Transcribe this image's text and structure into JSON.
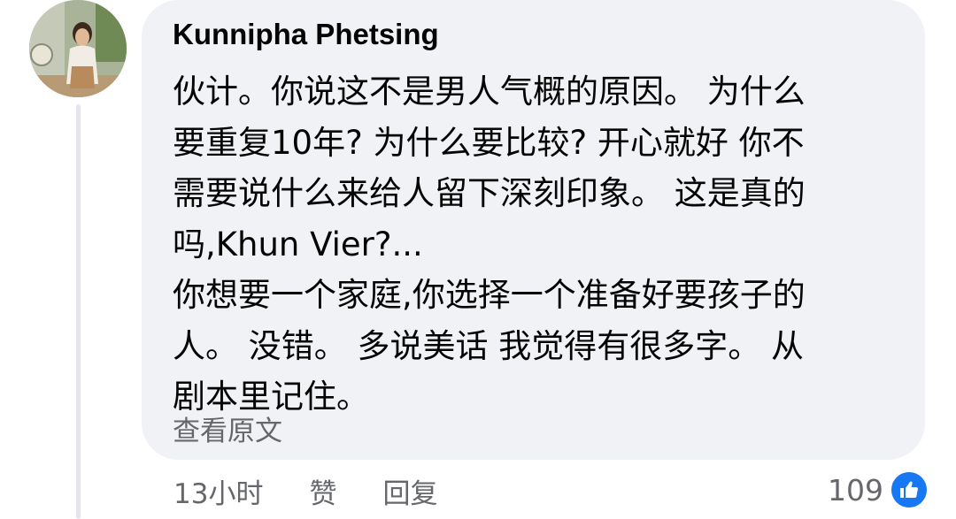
{
  "comment": {
    "author": "Kunnipha Phetsing",
    "text": "伙计。你说这不是男人气概的原因。 为什么\n要重复10年? 为什么要比较? 开心就好 你不\n需要说什么来给人留下深刻印象。 这是真的\n吗,Khun Vier?...\n你想要一个家庭,你选择一个准备好要孩子的\n人。 没错。 多说美话 我觉得有很多字。 从\n剧本里记住。",
    "see_original": "查看原文"
  },
  "actions": {
    "time": "13小时",
    "like": "赞",
    "reply": "回复"
  },
  "reactions": {
    "count": "109",
    "icon": "thumbs-up-icon",
    "color": "#1877f2"
  },
  "colors": {
    "bubble": "#f0f2f5",
    "text": "#050505",
    "secondary": "#65676b",
    "thread_line": "#e4e6eb"
  }
}
